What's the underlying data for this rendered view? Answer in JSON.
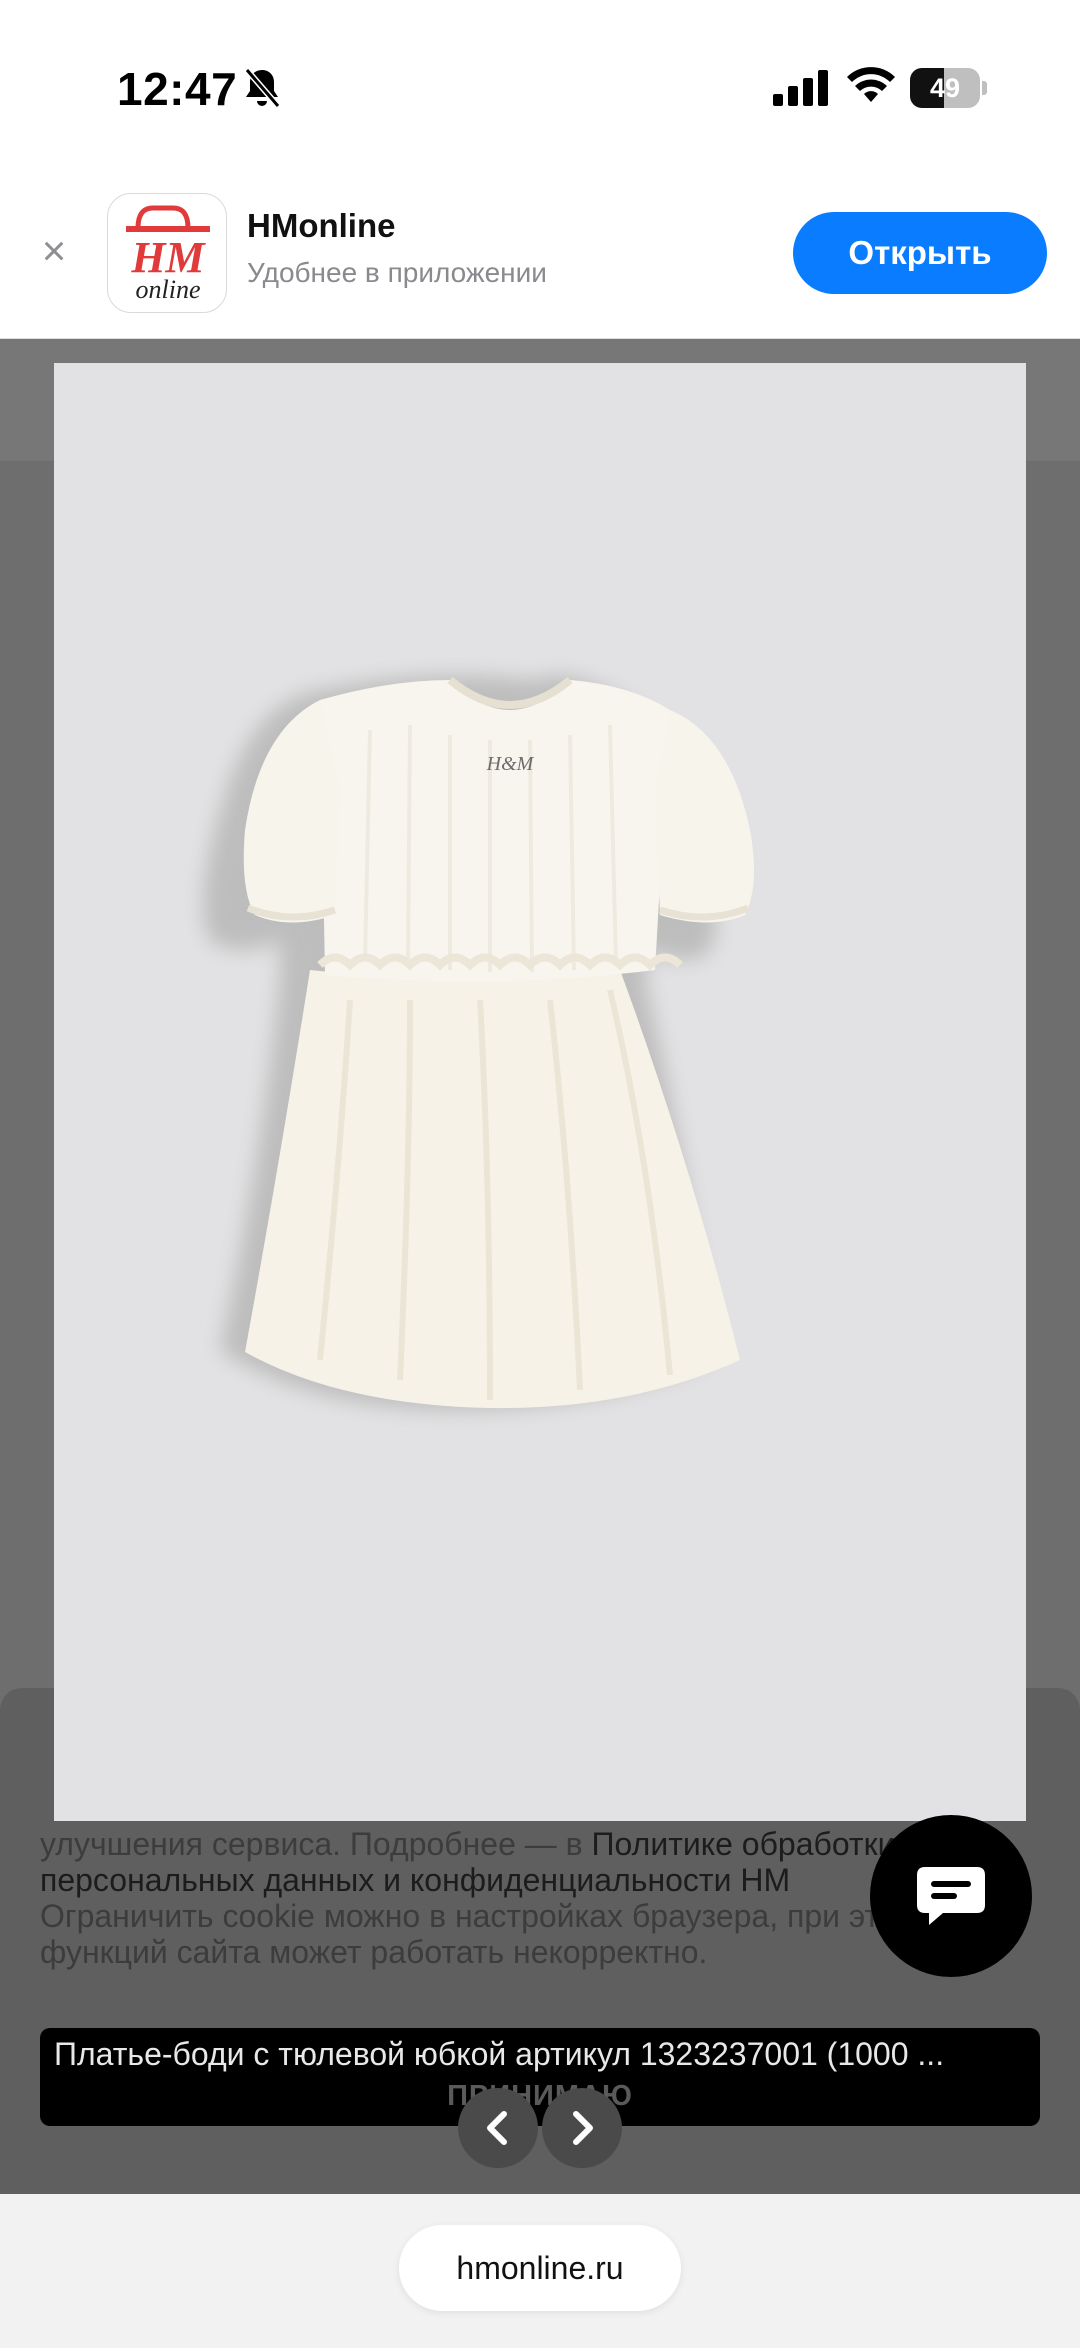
{
  "status_bar": {
    "time": "12:47",
    "battery_level": 49,
    "battery_text": "49"
  },
  "app_banner": {
    "app_name": "HMonline",
    "subtitle": "Удобнее в приложении",
    "open_label": "Открыть",
    "icon_line1": "HM",
    "icon_line2": "online",
    "brand_color": "#e03a3a",
    "button_color": "#0a7cff"
  },
  "cookie_notice": {
    "text_part1": "улучшения сервиса. Подробнее — в ",
    "policy_link": "Политике обработки персональных данных и конфиденциальности HM",
    "text_part2": "Ограничить cookie можно в настройках браузера, при этом часть функций сайта может работать некорректно.",
    "accept_label": "ПРИНИМАЮ"
  },
  "product": {
    "caption": "Платье-боди с тюлевой юбкой артикул 1323237001 (1000 ...",
    "label_brand": "H&M"
  },
  "bottom": {
    "url": "hmonline.ru"
  }
}
